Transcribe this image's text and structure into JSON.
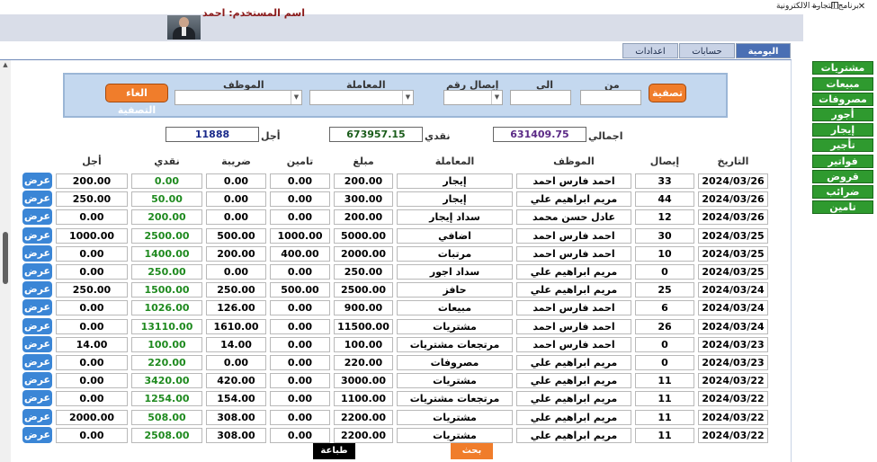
{
  "window": {
    "title": "برنامج التجارة الالكترونية",
    "minimize": "—",
    "restore": "❐",
    "close": "✕"
  },
  "header": {
    "user_label": "اسم المستخدم: احمد"
  },
  "tabs": [
    {
      "label": "اليومية"
    },
    {
      "label": "حسابات"
    },
    {
      "label": "اعدادات"
    }
  ],
  "filter": {
    "from_label": "من",
    "to_label": "الى",
    "receipt_label": "إيصال رقم",
    "transaction_label": "المعاملة",
    "employee_label": "الموظف",
    "filter_button": "تصفية",
    "clear_button": "الغاء التصفية"
  },
  "totals": {
    "total_label": "اجمالي",
    "total_value": "631409.75",
    "cash_label": "نقدي",
    "cash_value": "673957.15",
    "credit_label": "أجل",
    "credit_value": "11888"
  },
  "table": {
    "columns": {
      "date": "التاريخ",
      "receipt": "إيصال",
      "employee": "الموظف",
      "transaction": "المعاملة",
      "amount": "مبلغ",
      "insurance": "تامين",
      "tax": "ضريبة",
      "cash": "نقدي",
      "credit": "أجل"
    },
    "view_label": "عرض",
    "rows": [
      {
        "date": "2024/03/26",
        "receipt": "33",
        "employee": "احمد فارس احمد",
        "transaction": "إيجار",
        "amount": "200.00",
        "insurance": "0.00",
        "tax": "0.00",
        "cash": "0.00",
        "credit": "200.00"
      },
      {
        "date": "2024/03/26",
        "receipt": "44",
        "employee": "مريم ابراهيم علي",
        "transaction": "إيجار",
        "amount": "300.00",
        "insurance": "0.00",
        "tax": "0.00",
        "cash": "50.00",
        "credit": "250.00"
      },
      {
        "date": "2024/03/26",
        "receipt": "12",
        "employee": "عادل حسن محمد",
        "transaction": "سداد إيجار",
        "amount": "200.00",
        "insurance": "0.00",
        "tax": "0.00",
        "cash": "200.00",
        "credit": "0.00"
      },
      {
        "date": "2024/03/25",
        "receipt": "30",
        "employee": "احمد فارس احمد",
        "transaction": "اضافي",
        "amount": "5000.00",
        "insurance": "1000.00",
        "tax": "500.00",
        "cash": "2500.00",
        "credit": "1000.00"
      },
      {
        "date": "2024/03/25",
        "receipt": "10",
        "employee": "احمد فارس احمد",
        "transaction": "مرتبات",
        "amount": "2000.00",
        "insurance": "400.00",
        "tax": "200.00",
        "cash": "1400.00",
        "credit": "0.00"
      },
      {
        "date": "2024/03/25",
        "receipt": "0",
        "employee": "مريم ابراهيم علي",
        "transaction": "سداد اجور",
        "amount": "250.00",
        "insurance": "0.00",
        "tax": "0.00",
        "cash": "250.00",
        "credit": "0.00"
      },
      {
        "date": "2024/03/24",
        "receipt": "25",
        "employee": "مريم ابراهيم علي",
        "transaction": "حافز",
        "amount": "2500.00",
        "insurance": "500.00",
        "tax": "250.00",
        "cash": "1500.00",
        "credit": "250.00"
      },
      {
        "date": "2024/03/24",
        "receipt": "6",
        "employee": "احمد فارس احمد",
        "transaction": "مبيعات",
        "amount": "900.00",
        "insurance": "0.00",
        "tax": "126.00",
        "cash": "1026.00",
        "credit": "0.00"
      },
      {
        "date": "2024/03/24",
        "receipt": "26",
        "employee": "احمد فارس احمد",
        "transaction": "مشتريات",
        "amount": "11500.00",
        "insurance": "0.00",
        "tax": "1610.00",
        "cash": "13110.00",
        "credit": "0.00"
      },
      {
        "date": "2024/03/23",
        "receipt": "0",
        "employee": "احمد فارس احمد",
        "transaction": "مرتجعات مشتريات",
        "amount": "100.00",
        "insurance": "0.00",
        "tax": "14.00",
        "cash": "100.00",
        "credit": "14.00"
      },
      {
        "date": "2024/03/23",
        "receipt": "0",
        "employee": "مريم ابراهيم علي",
        "transaction": "مصروفات",
        "amount": "220.00",
        "insurance": "0.00",
        "tax": "0.00",
        "cash": "220.00",
        "credit": "0.00"
      },
      {
        "date": "2024/03/22",
        "receipt": "11",
        "employee": "مريم ابراهيم علي",
        "transaction": "مشتريات",
        "amount": "3000.00",
        "insurance": "0.00",
        "tax": "420.00",
        "cash": "3420.00",
        "credit": "0.00"
      },
      {
        "date": "2024/03/22",
        "receipt": "11",
        "employee": "مريم ابراهيم علي",
        "transaction": "مرتجعات مشتريات",
        "amount": "1100.00",
        "insurance": "0.00",
        "tax": "154.00",
        "cash": "1254.00",
        "credit": "0.00"
      },
      {
        "date": "2024/03/22",
        "receipt": "11",
        "employee": "مريم ابراهيم علي",
        "transaction": "مشتريات",
        "amount": "2200.00",
        "insurance": "0.00",
        "tax": "308.00",
        "cash": "508.00",
        "credit": "2000.00"
      },
      {
        "date": "2024/03/22",
        "receipt": "11",
        "employee": "مريم ابراهيم علي",
        "transaction": "مشتريات",
        "amount": "2200.00",
        "insurance": "0.00",
        "tax": "308.00",
        "cash": "2508.00",
        "credit": "0.00"
      }
    ]
  },
  "buttons": {
    "print": "طباعة",
    "search": "بحث"
  },
  "side_menu": [
    {
      "label": "مشتريات"
    },
    {
      "label": "مبيعات"
    },
    {
      "label": "مصروفات"
    },
    {
      "label": "أجور"
    },
    {
      "label": "إيجار"
    },
    {
      "label": "تأجير"
    },
    {
      "label": "فواتير"
    },
    {
      "label": "قروض"
    },
    {
      "label": "ضرائب"
    },
    {
      "label": "تامين"
    }
  ],
  "colors": {
    "accent_orange": "#f07d2b",
    "menu_green": "#2f9a2f",
    "view_blue": "#3b86d6",
    "cash_green": "#1f8a1f",
    "total_purple": "#5b2a86",
    "cash_box_green": "#1a5c1a",
    "credit_blue": "#1a2a8a"
  }
}
